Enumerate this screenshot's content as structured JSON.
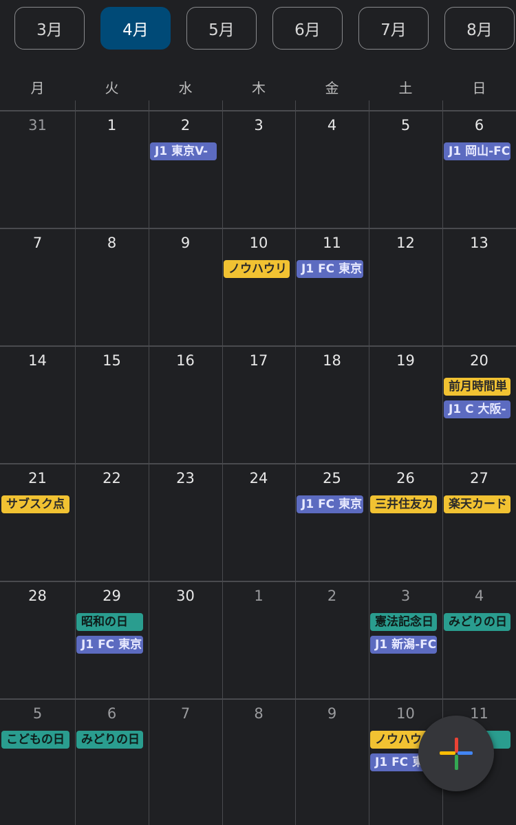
{
  "month_tabs": [
    {
      "label": "3月",
      "active": false
    },
    {
      "label": "4月",
      "active": true
    },
    {
      "label": "5月",
      "active": false
    },
    {
      "label": "6月",
      "active": false
    },
    {
      "label": "7月",
      "active": false
    },
    {
      "label": "8月",
      "active": false
    }
  ],
  "weekdays": [
    "月",
    "火",
    "水",
    "木",
    "金",
    "土",
    "日"
  ],
  "weeks": [
    [
      {
        "d": "31",
        "muted": true
      },
      {
        "d": "1"
      },
      {
        "d": "2",
        "events": [
          {
            "t": "J1 東京V-",
            "c": "blue"
          }
        ]
      },
      {
        "d": "3"
      },
      {
        "d": "4"
      },
      {
        "d": "5"
      },
      {
        "d": "6",
        "events": [
          {
            "t": "J1 岡山-FC",
            "c": "blue"
          }
        ]
      }
    ],
    [
      {
        "d": "7"
      },
      {
        "d": "8"
      },
      {
        "d": "9"
      },
      {
        "d": "10",
        "events": [
          {
            "t": "ノウハウリ",
            "c": "yellow"
          }
        ]
      },
      {
        "d": "11",
        "events": [
          {
            "t": "J1 FC 東京",
            "c": "blue"
          }
        ]
      },
      {
        "d": "12"
      },
      {
        "d": "13"
      }
    ],
    [
      {
        "d": "14"
      },
      {
        "d": "15"
      },
      {
        "d": "16"
      },
      {
        "d": "17"
      },
      {
        "d": "18"
      },
      {
        "d": "19"
      },
      {
        "d": "20",
        "events": [
          {
            "t": "前月時間単",
            "c": "yellow"
          },
          {
            "t": "J1 C 大阪-",
            "c": "blue"
          }
        ]
      }
    ],
    [
      {
        "d": "21",
        "events": [
          {
            "t": "サブスク点",
            "c": "yellow"
          }
        ]
      },
      {
        "d": "22"
      },
      {
        "d": "23"
      },
      {
        "d": "24"
      },
      {
        "d": "25",
        "events": [
          {
            "t": "J1 FC 東京",
            "c": "blue"
          }
        ]
      },
      {
        "d": "26",
        "events": [
          {
            "t": "三井住友カ",
            "c": "yellow"
          }
        ]
      },
      {
        "d": "27",
        "events": [
          {
            "t": "楽天カード",
            "c": "yellow"
          }
        ]
      }
    ],
    [
      {
        "d": "28"
      },
      {
        "d": "29",
        "events": [
          {
            "t": "昭和の日",
            "c": "teal"
          },
          {
            "t": "J1 FC 東京",
            "c": "blue"
          }
        ]
      },
      {
        "d": "30"
      },
      {
        "d": "1",
        "muted": true
      },
      {
        "d": "2",
        "muted": true
      },
      {
        "d": "3",
        "muted": true,
        "events": [
          {
            "t": "憲法記念日",
            "c": "teal"
          },
          {
            "t": "J1 新潟-FC",
            "c": "blue"
          }
        ]
      },
      {
        "d": "4",
        "muted": true,
        "events": [
          {
            "t": "みどりの日",
            "c": "teal"
          }
        ]
      }
    ],
    [
      {
        "d": "5",
        "muted": true,
        "events": [
          {
            "t": "こどもの日",
            "c": "teal"
          }
        ]
      },
      {
        "d": "6",
        "muted": true,
        "events": [
          {
            "t": "みどりの日",
            "c": "teal"
          }
        ]
      },
      {
        "d": "7",
        "muted": true
      },
      {
        "d": "8",
        "muted": true
      },
      {
        "d": "9",
        "muted": true
      },
      {
        "d": "10",
        "muted": true,
        "events": [
          {
            "t": "ノウハウリ",
            "c": "yellow"
          },
          {
            "t": "J1 FC 東京",
            "c": "blue"
          }
        ]
      },
      {
        "d": "11",
        "muted": true,
        "events": [
          {
            "t": "",
            "c": "teal"
          }
        ]
      }
    ]
  ],
  "fab": {
    "icon": "plus-icon"
  }
}
